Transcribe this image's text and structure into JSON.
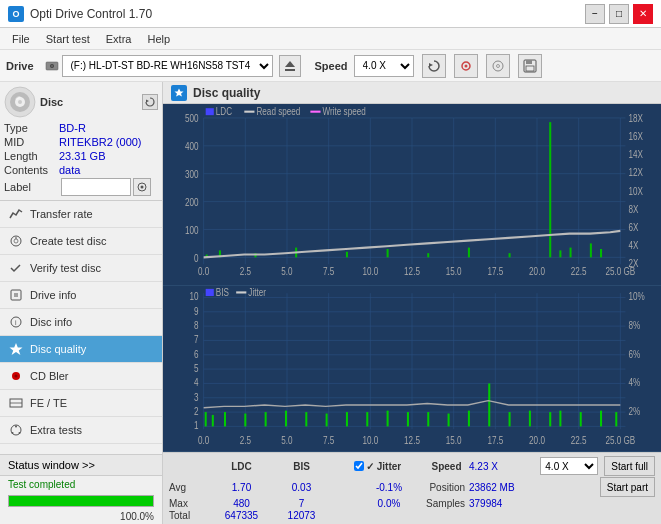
{
  "titleBar": {
    "appName": "Opti Drive Control 1.70",
    "minBtn": "−",
    "maxBtn": "□",
    "closeBtn": "✕"
  },
  "menuBar": {
    "items": [
      "File",
      "Start test",
      "Extra",
      "Help"
    ]
  },
  "toolbar": {
    "driveLabel": "Drive",
    "driveValue": "(F:)  HL-DT-ST BD-RE  WH16NS58 TST4",
    "speedLabel": "Speed",
    "speedValue": "4.0 X"
  },
  "disc": {
    "header": "Disc",
    "typeLabel": "Type",
    "typeValue": "BD-R",
    "midLabel": "MID",
    "midValue": "RITEKBR2 (000)",
    "lengthLabel": "Length",
    "lengthValue": "23.31 GB",
    "contentsLabel": "Contents",
    "contentsValue": "data",
    "labelLabel": "Label"
  },
  "navItems": [
    {
      "id": "transfer-rate",
      "label": "Transfer rate",
      "icon": "📈"
    },
    {
      "id": "create-test-disc",
      "label": "Create test disc",
      "icon": "💿"
    },
    {
      "id": "verify-test-disc",
      "label": "Verify test disc",
      "icon": "✔"
    },
    {
      "id": "drive-info",
      "label": "Drive info",
      "icon": "ℹ"
    },
    {
      "id": "disc-info",
      "label": "Disc info",
      "icon": "📋"
    },
    {
      "id": "disc-quality",
      "label": "Disc quality",
      "icon": "★",
      "active": true
    },
    {
      "id": "cd-bler",
      "label": "CD Bler",
      "icon": "🔴"
    },
    {
      "id": "fe-te",
      "label": "FE / TE",
      "icon": "📊"
    },
    {
      "id": "extra-tests",
      "label": "Extra tests",
      "icon": "⚙"
    }
  ],
  "statusSection": {
    "btnLabel": "Status window >>",
    "statusText": "Test completed",
    "progressValue": 100
  },
  "discQuality": {
    "title": "Disc quality"
  },
  "chart1": {
    "legendLDC": "LDC",
    "legendRead": "Read speed",
    "legendWrite": "Write speed",
    "yMax": 500,
    "yLabels": [
      "500",
      "400",
      "300",
      "200",
      "100",
      "0"
    ],
    "yRightLabels": [
      "18X",
      "16X",
      "14X",
      "12X",
      "10X",
      "8X",
      "6X",
      "4X",
      "2X"
    ],
    "xLabels": [
      "0.0",
      "2.5",
      "5.0",
      "7.5",
      "10.0",
      "12.5",
      "15.0",
      "17.5",
      "20.0",
      "22.5",
      "25.0 GB"
    ]
  },
  "chart2": {
    "legendBIS": "BIS",
    "legendJitter": "Jitter",
    "yLabels": [
      "10",
      "9",
      "8",
      "7",
      "6",
      "5",
      "4",
      "3",
      "2",
      "1"
    ],
    "yRightLabels": [
      "10%",
      "8%",
      "6%",
      "4%",
      "2%"
    ],
    "xLabels": [
      "0.0",
      "2.5",
      "5.0",
      "7.5",
      "10.0",
      "12.5",
      "15.0",
      "17.5",
      "20.0",
      "22.5",
      "25.0 GB"
    ]
  },
  "stats": {
    "headers": [
      "",
      "LDC",
      "BIS",
      "",
      "Jitter",
      "Speed",
      ""
    ],
    "avgLabel": "Avg",
    "avgLDC": "1.70",
    "avgBIS": "0.03",
    "avgJitter": "-0.1%",
    "maxLabel": "Max",
    "maxLDC": "480",
    "maxBIS": "7",
    "maxJitter": "0.0%",
    "totalLabel": "Total",
    "totalLDC": "647335",
    "totalBIS": "12073",
    "speedLabel": "Speed",
    "speedValue": "4.23 X",
    "speedSelectValue": "4.0 X",
    "positionLabel": "Position",
    "positionValue": "23862 MB",
    "samplesLabel": "Samples",
    "samplesValue": "379984",
    "startFullBtn": "Start full",
    "startPartBtn": "Start part",
    "jitterLabel": "✓ Jitter"
  }
}
